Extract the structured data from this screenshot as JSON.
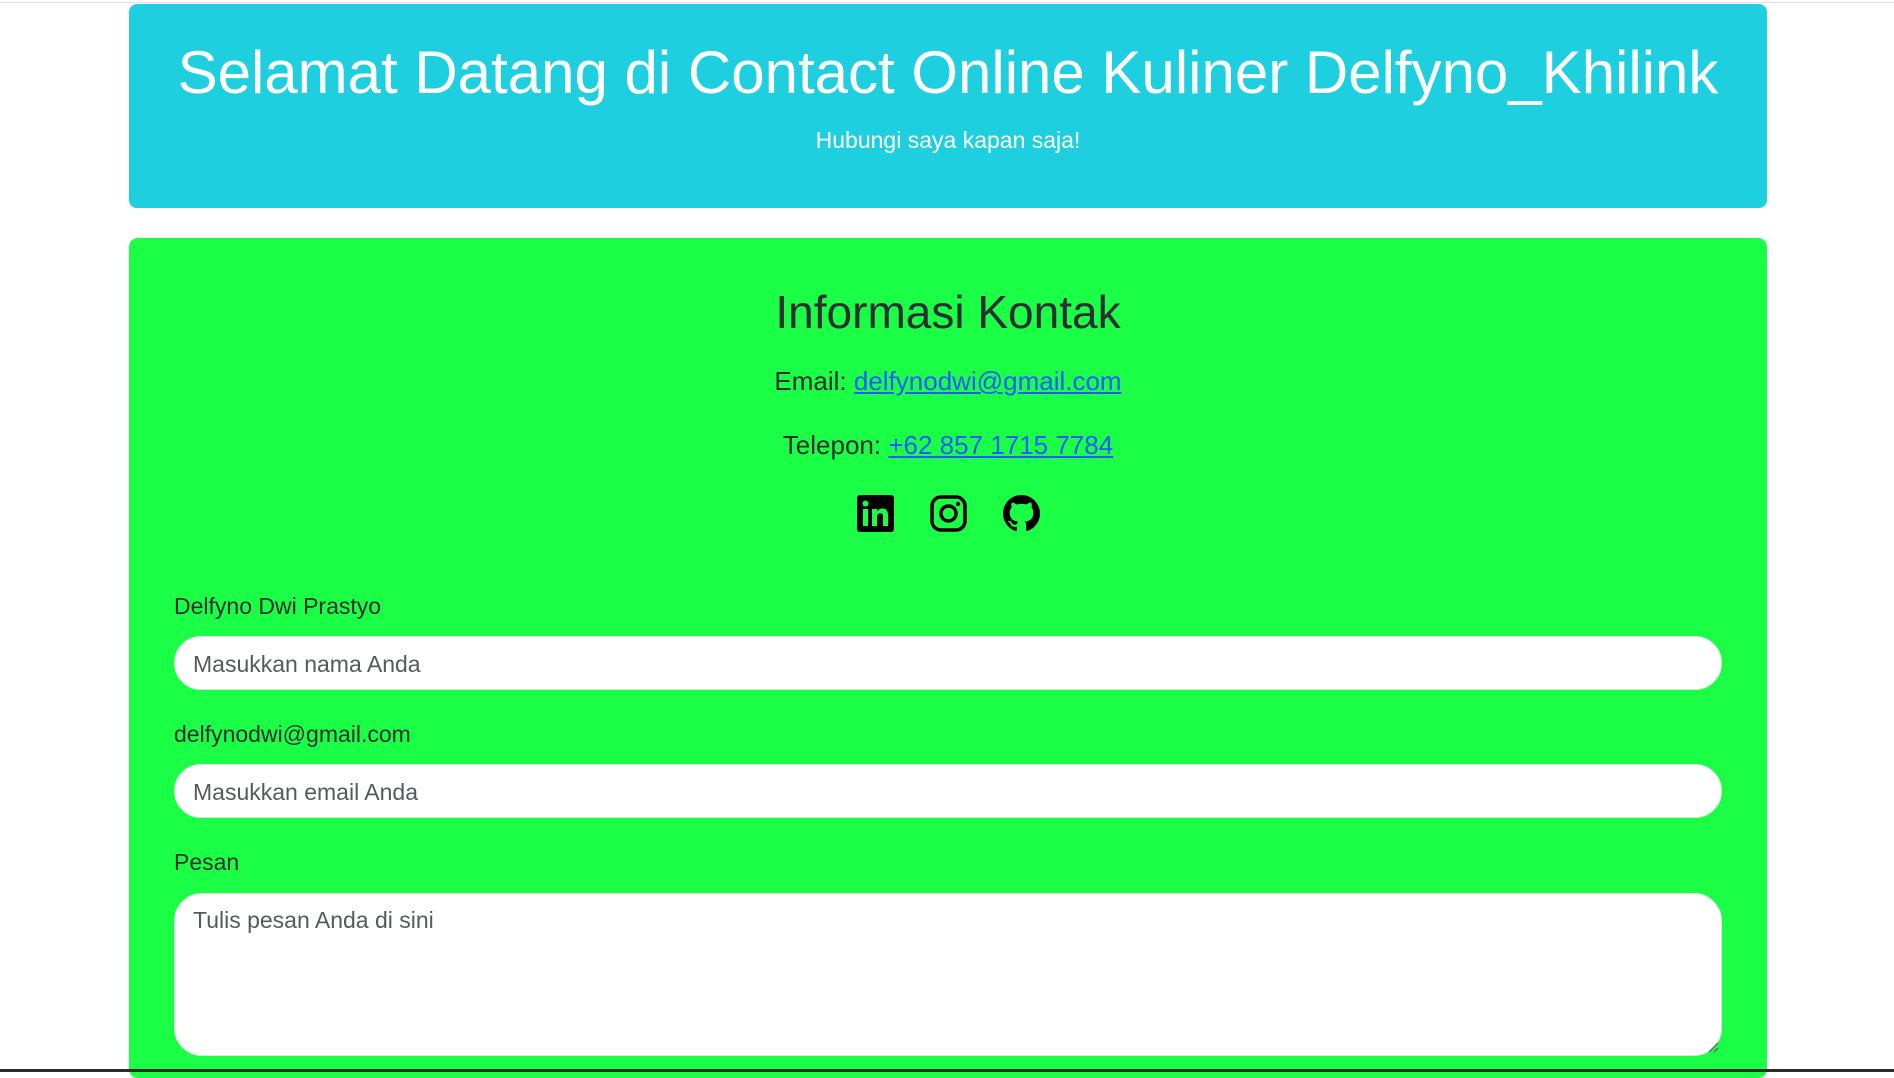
{
  "header": {
    "title": "Selamat Datang di Contact Online Kuliner Delfyno_Khilink",
    "subtitle": "Hubungi saya kapan saja!"
  },
  "contact_info": {
    "heading": "Informasi Kontak",
    "email_label": "Email:",
    "email_value": "delfynodwi@gmail.com",
    "phone_label": "Telepon:",
    "phone_value": "+62 857 1715 7784"
  },
  "socials": [
    {
      "name": "linkedin-icon"
    },
    {
      "name": "instagram-icon"
    },
    {
      "name": "github-icon"
    }
  ],
  "form": {
    "name_label": "Delfyno Dwi Prastyo",
    "name_placeholder": "Masukkan nama Anda",
    "email_label": "delfynodwi@gmail.com",
    "email_placeholder": "Masukkan email Anda",
    "message_label": "Pesan",
    "message_placeholder": "Tulis pesan Anda di sini"
  },
  "colors": {
    "header_bg": "#1ecfe0",
    "panel_bg": "#1aff45",
    "link": "#1a5cff",
    "text": "#2b2f33"
  }
}
